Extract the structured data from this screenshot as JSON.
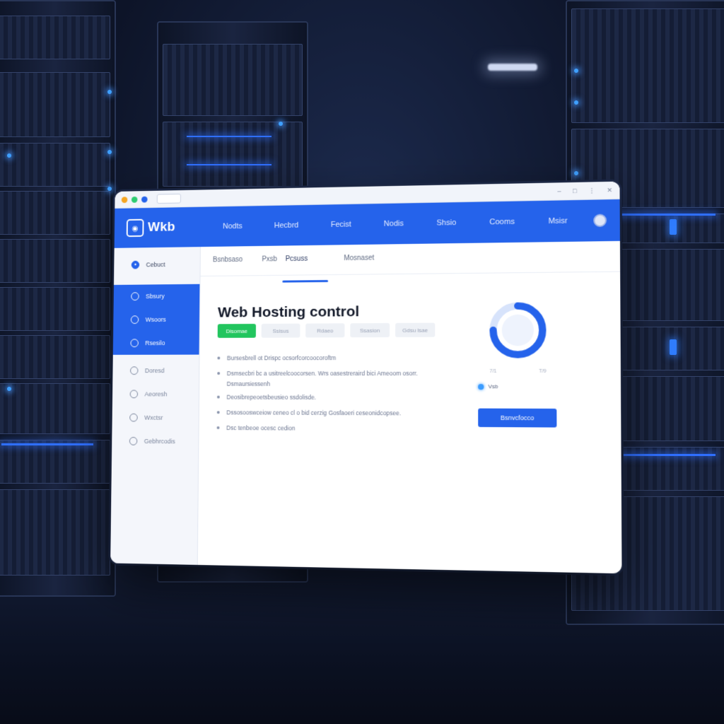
{
  "window": {
    "traffic_lights": [
      "#f5a623",
      "#2ecc71",
      "#2563eb"
    ]
  },
  "header": {
    "logo_text": "Wkb",
    "nav": [
      "Nodts",
      "Hecbrd",
      "Fecist",
      "Nodis",
      "Shsio",
      "Cooms",
      "Msisr"
    ]
  },
  "sidebar": {
    "items": [
      {
        "label": "Cebuct",
        "icon": "dashboard-icon",
        "active": false
      },
      {
        "label": "Sbsury",
        "icon": "globe-icon",
        "active": true
      },
      {
        "label": "Wsoors",
        "icon": "server-icon",
        "active": true
      },
      {
        "label": "Rsesilo",
        "icon": "database-icon",
        "active": true
      },
      {
        "label": "Doresd",
        "icon": "mail-icon",
        "active": false
      },
      {
        "label": "Aeoresh",
        "icon": "shield-icon",
        "active": false
      },
      {
        "label": "Wxctsr",
        "icon": "settings-icon",
        "active": false
      },
      {
        "label": "Gebhrcodis",
        "icon": "help-icon",
        "active": false
      }
    ]
  },
  "subtabs": [
    "Bsnbsaso",
    "Pxsb",
    "Pcsuss",
    "Mosnaset"
  ],
  "main": {
    "title": "Web Hosting control",
    "filters": [
      {
        "label": "Disomae",
        "active": true
      },
      {
        "label": "Ssisus",
        "active": false
      },
      {
        "label": "Rdaeo",
        "active": false
      },
      {
        "label": "Ssasion",
        "active": false
      },
      {
        "label": "Gdsu lsae",
        "active": false
      }
    ],
    "bullets": [
      {
        "text": "Bursesbrell ot Drispc ocsorfcorcoocoroftm",
        "cont": ""
      },
      {
        "text": "Dsmsecbri bc a usitreelcoocorsen. Wrs oasestreraird bici Ameoom osorr.",
        "cont": "Dsmaursiessenh"
      },
      {
        "text": "Deosibrepeoetsbeusieo ssdolisde.",
        "cont": ""
      },
      {
        "text": "Dssosooswceiow ceneo cl o bid cerzig Gosfaoeri ceseonidcopsee.",
        "cont": ""
      },
      {
        "text": "Dsc tenbeoe ocesc cedion",
        "cont": ""
      }
    ]
  },
  "gauge": {
    "fraction": 0.75,
    "track_color": "#d7e3fb",
    "fill_color": "#2563eb",
    "labels": [
      "7/1",
      "T/9"
    ]
  },
  "legend": {
    "label": "Vsb"
  },
  "cta": {
    "label": "Bsnvcfocco"
  }
}
